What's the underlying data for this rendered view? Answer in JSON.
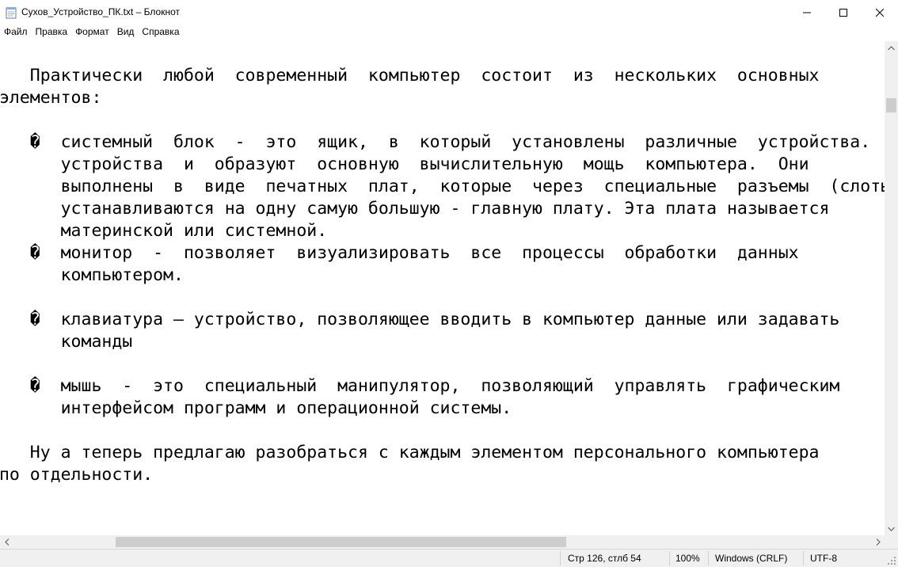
{
  "window": {
    "title": "Сухов_Устройство_ПК.txt – Блокнот",
    "icon": "notepad-icon"
  },
  "menu": [
    "Файл",
    "Правка",
    "Формат",
    "Вид",
    "Справка"
  ],
  "editor": {
    "lines": [
      "    Практически  любой  современный  компьютер  состоит  из  нескольких  основных",
      " элементов:",
      "",
      "    �  системный  блок  -  это  ящик,  в  который  установлены  различные  устройства.",
      "       устройства  и  образуют  основную  вычислительную  мощь  компьютера.  Они",
      "       выполнены  в  виде  печатных  плат,  которые  через  специальные  разъемы  (слоты",
      "       устанавливаются на одну самую большую - главную плату. Эта плата называется",
      "       материнской или системной.",
      "    �  монитор  -  позволяет  визуализировать  все  процессы  обработки  данных",
      "       компьютером.",
      "",
      "    �  клавиатура – устройство, позволяющее вводить в компьютер данные или задавать",
      "       команды",
      "",
      "    �  мышь  -  это  специальный  манипулятор,  позволяющий  управлять  графическим",
      "       интерфейсом программ и операционной системы.",
      "",
      "    Ну а теперь предлагаю разобраться с каждым элементом персонального компьютера",
      " по отдельности."
    ]
  },
  "status": {
    "position": "Стр 126, стлб 54",
    "zoom": "100%",
    "line_ending": "Windows (CRLF)",
    "encoding": "UTF-8"
  },
  "scroll": {
    "vertical_fraction": 0.12,
    "horizontal_fraction": 0.15
  }
}
